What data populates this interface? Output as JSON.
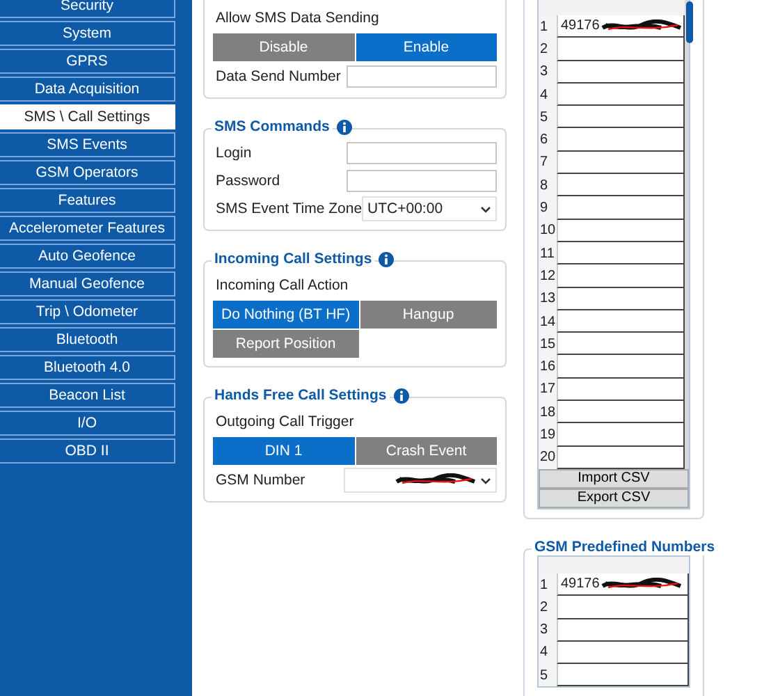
{
  "sidebar": {
    "items": [
      {
        "label": "Security",
        "selected": false
      },
      {
        "label": "System",
        "selected": false
      },
      {
        "label": "GPRS",
        "selected": false
      },
      {
        "label": "Data Acquisition",
        "selected": false
      },
      {
        "label": "SMS \\ Call Settings",
        "selected": true
      },
      {
        "label": "SMS Events",
        "selected": false
      },
      {
        "label": "GSM Operators",
        "selected": false
      },
      {
        "label": "Features",
        "selected": false
      },
      {
        "label": "Accelerometer Features",
        "selected": false
      },
      {
        "label": "Auto Geofence",
        "selected": false
      },
      {
        "label": "Manual Geofence",
        "selected": false
      },
      {
        "label": "Trip \\ Odometer",
        "selected": false
      },
      {
        "label": "Bluetooth",
        "selected": false
      },
      {
        "label": "Bluetooth 4.0",
        "selected": false
      },
      {
        "label": "Beacon List",
        "selected": false
      },
      {
        "label": "I/O",
        "selected": false
      },
      {
        "label": "OBD II",
        "selected": false
      }
    ]
  },
  "sections": [
    {
      "items": [
        {
          "kind": "label",
          "text": "Allow SMS Data Sending"
        },
        {
          "kind": "toggle",
          "options": [
            {
              "label": "Disable",
              "selected": false
            },
            {
              "label": "Enable",
              "selected": true
            }
          ]
        },
        {
          "kind": "field",
          "label": "Data Send Number"
        }
      ]
    },
    {
      "title": "SMS Commands",
      "items": [
        {
          "kind": "field",
          "label": "Login"
        },
        {
          "kind": "field",
          "label": "Password"
        },
        {
          "kind": "select",
          "label": "SMS Event Time Zone",
          "value": "UTC+00:00",
          "redacted": false
        }
      ]
    },
    {
      "title": "Incoming Call Settings",
      "items": [
        {
          "kind": "label",
          "text": "Incoming Call Action"
        },
        {
          "kind": "toggle",
          "options": [
            {
              "label": "Do Nothing (BT HF)",
              "selected": true
            },
            {
              "label": "Hangup",
              "selected": false
            },
            {
              "label": "Report Position",
              "selected": false
            }
          ]
        }
      ]
    },
    {
      "title": "Hands Free Call Settings",
      "items": [
        {
          "kind": "label",
          "text": "Outgoing Call Trigger"
        },
        {
          "kind": "toggle",
          "options": [
            {
              "label": "DIN 1",
              "selected": true
            },
            {
              "label": "Crash Event",
              "selected": false
            }
          ]
        },
        {
          "kind": "select",
          "label": "GSM Number",
          "value": "",
          "redacted": true
        }
      ]
    }
  ],
  "number_list": {
    "rows": [
      {
        "index": "1",
        "value": "49176",
        "redacted": true
      },
      {
        "index": "2"
      },
      {
        "index": "3"
      },
      {
        "index": "4"
      },
      {
        "index": "5"
      },
      {
        "index": "6"
      },
      {
        "index": "7"
      },
      {
        "index": "8"
      },
      {
        "index": "9"
      },
      {
        "index": "10"
      },
      {
        "index": "11"
      },
      {
        "index": "12"
      },
      {
        "index": "13"
      },
      {
        "index": "14"
      },
      {
        "index": "15"
      },
      {
        "index": "16"
      },
      {
        "index": "17"
      },
      {
        "index": "18"
      },
      {
        "index": "19"
      },
      {
        "index": "20"
      }
    ],
    "buttons": [
      "Import CSV",
      "Export CSV"
    ]
  },
  "gsm_predefined_numbers": {
    "title": "GSM Predefined Numbers",
    "rows": [
      {
        "index": "1",
        "value": "49176",
        "redacted": true
      },
      {
        "index": "2"
      },
      {
        "index": "3"
      },
      {
        "index": "4"
      },
      {
        "index": "5"
      }
    ]
  }
}
